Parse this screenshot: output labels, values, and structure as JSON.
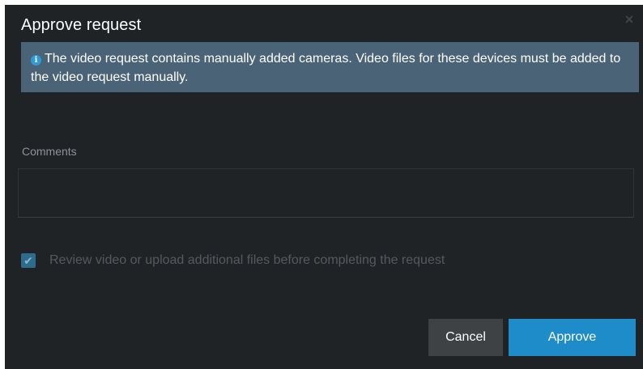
{
  "dialog": {
    "title": "Approve request",
    "close_icon": "close-icon",
    "info_icon_glyph": "i",
    "info_message": "The video request contains manually added cameras. Video files for these devices must be added to the video request manually.",
    "comments_label": "Comments",
    "comments_value": "",
    "checkbox_label": "Review video or upload additional files before completing the request",
    "checkbox_checked": true,
    "cancel_label": "Cancel",
    "approve_label": "Approve"
  },
  "colors": {
    "background": "#1f2326",
    "info_banner": "#4a6377",
    "info_icon": "#2f9bd6",
    "approve_button": "#1d8cc8",
    "cancel_button": "#3e4245"
  }
}
